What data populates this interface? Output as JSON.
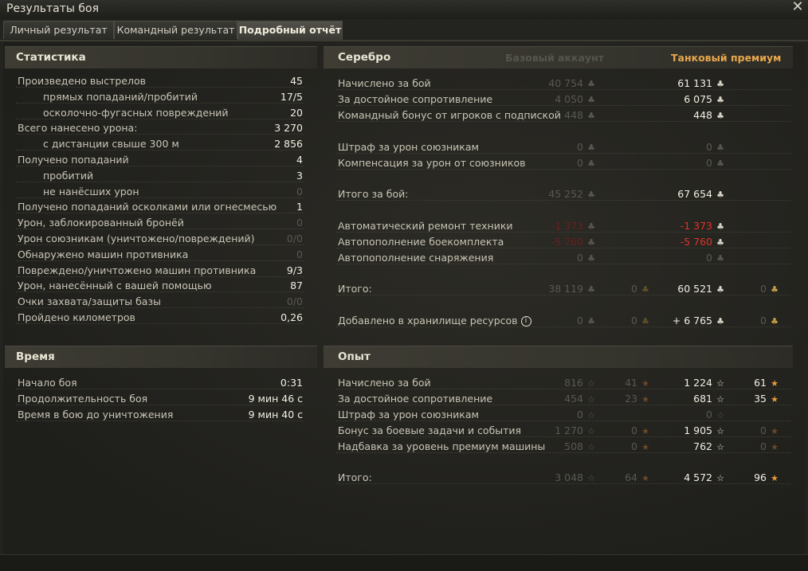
{
  "window": {
    "title": "Результаты боя",
    "close_glyph": "✕"
  },
  "tabs": [
    {
      "label": "Личный результат"
    },
    {
      "label": "Командный результат"
    },
    {
      "label": "Подробный отчёт"
    }
  ],
  "stats": {
    "title": "Статистика",
    "rows": [
      {
        "label": "Произведено выстрелов",
        "value": "45"
      },
      {
        "label": "прямых попаданий/пробитий",
        "value": "17/5"
      },
      {
        "label": "осколочно-фугасных повреждений",
        "value": "20"
      },
      {
        "label": "Всего нанесено урона:",
        "value": "3 270"
      },
      {
        "label": "с дистанции свыше 300 м",
        "value": "2 856"
      },
      {
        "label": "Получено попаданий",
        "value": "4"
      },
      {
        "label": "пробитий",
        "value": "3"
      },
      {
        "label": "не нанёсших урон",
        "value": "0"
      },
      {
        "label": "Получено попаданий осколками или огнесмесью",
        "value": "1"
      },
      {
        "label": "Урон, заблокированный бронёй",
        "value": "0"
      },
      {
        "label": "Урон союзникам (уничтожено/повреждений)",
        "value": "0/0"
      },
      {
        "label": "Обнаружено машин противника",
        "value": "0"
      },
      {
        "label": "Повреждено/уничтожено машин противника",
        "value": "9/3"
      },
      {
        "label": "Урон, нанесённый с вашей помощью",
        "value": "87"
      },
      {
        "label": "Очки захвата/защиты базы",
        "value": "0/0"
      },
      {
        "label": "Пройдено километров",
        "value": "0,26"
      }
    ]
  },
  "time": {
    "title": "Время",
    "rows": [
      {
        "label": "Начало боя",
        "value": "0:31"
      },
      {
        "label": "Продолжительность боя",
        "value": "9 мин 46 с"
      },
      {
        "label": "Время в бою до уничтожения",
        "value": "9 мин 40 с"
      }
    ]
  },
  "silver": {
    "title": "Серебро",
    "col_base": "Базовый аккаунт",
    "col_premium": "Танковый премиум",
    "rows": [
      {
        "label": "Начислено за бой",
        "base": "40 754",
        "prem": "61 131"
      },
      {
        "label": "За достойное сопротивление",
        "base": "4 050",
        "prem": "6 075"
      },
      {
        "label": "Командный бонус от игроков с подпиской",
        "base": "448",
        "prem": "448"
      },
      {
        "label": "Штраф за урон союзникам",
        "base": "0",
        "prem": "0"
      },
      {
        "label": "Компенсация за урон от союзников",
        "base": "0",
        "prem": "0"
      },
      {
        "label": "Итого за бой:",
        "base": "45 252",
        "prem": "67 654"
      },
      {
        "label": "Автоматический ремонт техники",
        "base": "-1 373",
        "prem": "-1 373"
      },
      {
        "label": "Автопополнение боекомплекта",
        "base": "-5 760",
        "prem": "-5 760"
      },
      {
        "label": "Автопополнение снаряжения",
        "base": "0",
        "prem": "0"
      },
      {
        "label": "Итого:",
        "base": "38 119",
        "base_gold": "0",
        "prem": "60 521",
        "prem_gold": "0"
      },
      {
        "label": "Добавлено в хранилище ресурсов",
        "base": "0",
        "base_gold": "0",
        "prem": "+ 6 765",
        "prem_gold": "0"
      }
    ]
  },
  "xp": {
    "title": "Опыт",
    "rows": [
      {
        "label": "Начислено за бой",
        "base": "816",
        "base_free": "41",
        "prem": "1 224",
        "prem_free": "61"
      },
      {
        "label": "За достойное сопротивление",
        "base": "454",
        "base_free": "23",
        "prem": "681",
        "prem_free": "35"
      },
      {
        "label": "Штраф за урон союзникам",
        "base": "0",
        "prem": "0"
      },
      {
        "label": "Бонус за боевые задачи и события",
        "base": "1 270",
        "base_free": "0",
        "prem": "1 905",
        "prem_free": "0"
      },
      {
        "label": "Надбавка за уровень премиум машины",
        "base": "508",
        "base_free": "0",
        "prem": "762",
        "prem_free": "0"
      },
      {
        "label": "Итого:",
        "base": "3 048",
        "base_free": "64",
        "prem": "4 572",
        "prem_free": "96"
      }
    ]
  },
  "icons": {
    "coin": "♣",
    "gold": "♣",
    "xp": "☆",
    "free_xp": "★",
    "info": "i"
  },
  "colors": {
    "premium_header": "#e8a84c",
    "penalty": "#e4302a",
    "dim_text": "#595850"
  }
}
